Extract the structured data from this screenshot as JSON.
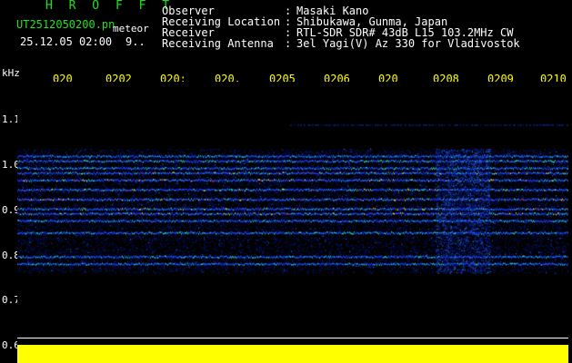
{
  "header": {
    "app_name": "H R O F F T",
    "filename": "UT2512050200.pn",
    "filename_suffix": "meteor",
    "date": "25.12.05 02:00",
    "number": "9.."
  },
  "meta": [
    {
      "key": "Observer",
      "value": "Masaki Kano"
    },
    {
      "key": "Receiving Location",
      "value": "Shibukawa, Gunma, Japan"
    },
    {
      "key": "Receiver",
      "value": "RTL-SDR SDR# 43dB L15 103.2MHz CW"
    },
    {
      "key": "Receiving Antenna",
      "value": "3el Yagi(V) Az 330 for Vladivostok"
    }
  ],
  "axes": {
    "y_unit": "kHz",
    "y_ticks": [
      "1.1",
      "1.0",
      "0.9",
      "0.8",
      "0.7",
      "0.6"
    ],
    "x_ticks": [
      "020",
      "0202",
      "020:",
      "020.",
      "0205",
      "0206",
      "020",
      "0208",
      "0209",
      "0210"
    ]
  },
  "colors": {
    "header_green": "#21e021",
    "tick_yellow": "#ffff00",
    "background": "#000000"
  },
  "spectrogram": {
    "y_min": 0.6,
    "y_max": 1.15,
    "bands_khz": [
      0.995,
      0.985,
      0.97,
      0.96,
      0.945,
      0.925,
      0.905,
      0.885,
      0.875,
      0.86,
      0.835,
      0.785,
      0.77
    ]
  }
}
